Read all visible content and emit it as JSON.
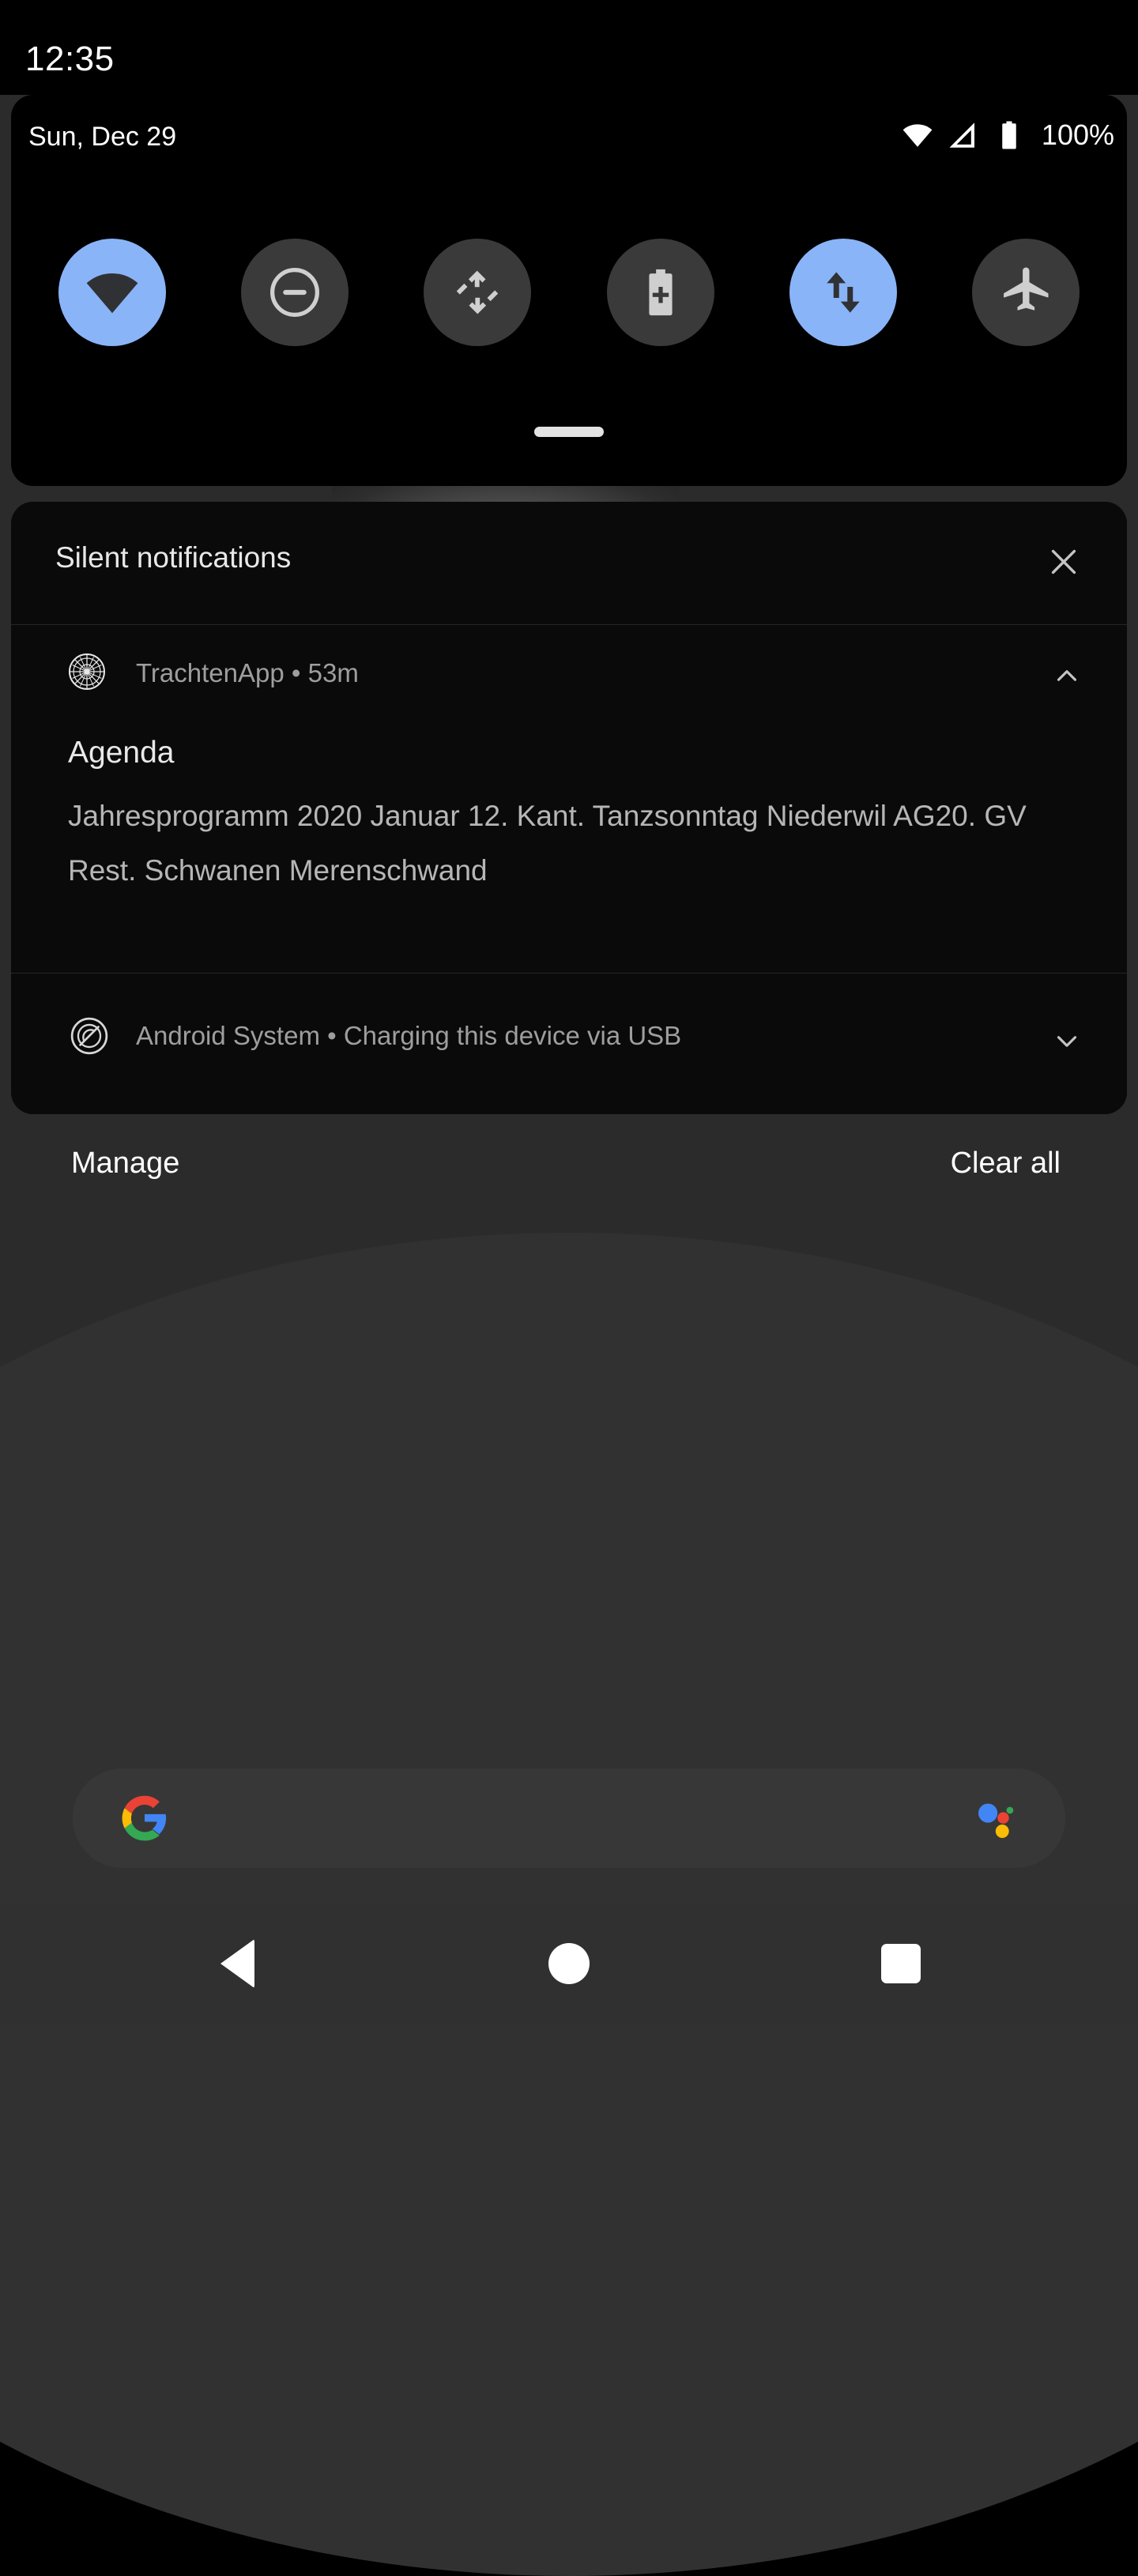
{
  "status_bar": {
    "clock": "12:35"
  },
  "quick_settings": {
    "date": "Sun, Dec 29",
    "battery_percent": "100%",
    "status_icons": [
      {
        "name": "wifi-icon",
        "label": "Wi-Fi full signal"
      },
      {
        "name": "cellular-signal-icon",
        "label": "Mobile signal"
      },
      {
        "name": "battery-icon",
        "label": "Battery full"
      }
    ],
    "tiles": [
      {
        "name": "wifi-tile",
        "label": "Wi-Fi",
        "icon": "wifi-icon",
        "active": true
      },
      {
        "name": "dnd-tile",
        "label": "Do Not Disturb",
        "icon": "do-not-disturb-icon",
        "active": false
      },
      {
        "name": "auto-rotate-tile",
        "label": "Auto-rotate",
        "icon": "auto-rotate-icon",
        "active": false
      },
      {
        "name": "battery-saver-tile",
        "label": "Battery Saver",
        "icon": "battery-plus-icon",
        "active": false
      },
      {
        "name": "mobile-data-tile",
        "label": "Mobile data",
        "icon": "data-transfer-icon",
        "active": true
      },
      {
        "name": "airplane-tile",
        "label": "Airplane mode",
        "icon": "airplane-icon",
        "active": false
      }
    ],
    "accent_color": "#8ab4f8",
    "inactive_color": "#3a3a3a"
  },
  "notifications": {
    "section_header": "Silent notifications",
    "close_label": "Close silent notifications",
    "items": [
      {
        "app_name": "TrachtenApp",
        "separator": "•",
        "time": "53m",
        "header_line": "TrachtenApp • 53m",
        "title": "Agenda",
        "body": "Jahresprogramm 2020 Januar 12. Kant. Tanzsonntag Niederwil AG20. GV Rest. Schwanen Merenschwand",
        "expanded": true,
        "icon": "rosette-icon"
      },
      {
        "app_name": "Android System",
        "separator": "•",
        "summary": "Charging this device via USB",
        "header_line": "Android System • Charging this device via USB",
        "expanded": false,
        "icon": "android-head-icon"
      }
    ]
  },
  "shade_actions": {
    "manage": "Manage",
    "clear_all": "Clear all"
  },
  "home_screen": {
    "search_widget": {
      "google_logo": "google-g-icon",
      "assistant": "google-assistant-icon"
    }
  },
  "navigation_bar": {
    "back": "Back",
    "home": "Home",
    "recents": "Recent apps"
  }
}
